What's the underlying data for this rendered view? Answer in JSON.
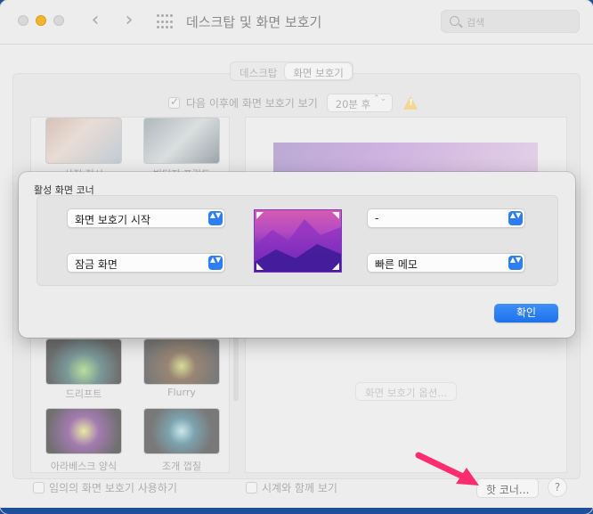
{
  "window": {
    "title": "데스크탑 및 화면 보호기",
    "search_placeholder": "검색"
  },
  "tabs": [
    {
      "label": "데스크탑",
      "active": false
    },
    {
      "label": "화면 보호기",
      "active": true
    }
  ],
  "start_after": {
    "checked": true,
    "label": "다음 이후에 화면 보호기 보기",
    "value": "20분 후",
    "updown_glyph": "⌃⌄"
  },
  "savers": {
    "photo1_label": "사진 전시",
    "photo2_label": "빈티지 프린트",
    "drift_label": "드리프트",
    "flurry_label": "Flurry",
    "arabesque_label": "아라베스크 양식",
    "shell_label": "조개 껍질"
  },
  "preview": {
    "options_button": "화면 보호기 옵션..."
  },
  "bottom": {
    "random_label": "임의의 화면 보호기 사용하기",
    "clock_label": "시계와 함께 보기",
    "hot_corners_button": "핫 코너...",
    "help_button": "?"
  },
  "sheet": {
    "title": "활성 화면 코너",
    "top_left": "화면 보호기 시작",
    "top_right": "-",
    "bottom_left": "잠금 화면",
    "bottom_right": "빠른 메모",
    "ok_button": "확인",
    "chevron_glyph": "▲▼"
  },
  "colors": {
    "accent": "#2c7ef2",
    "annotation_arrow": "#ff2d6f"
  }
}
